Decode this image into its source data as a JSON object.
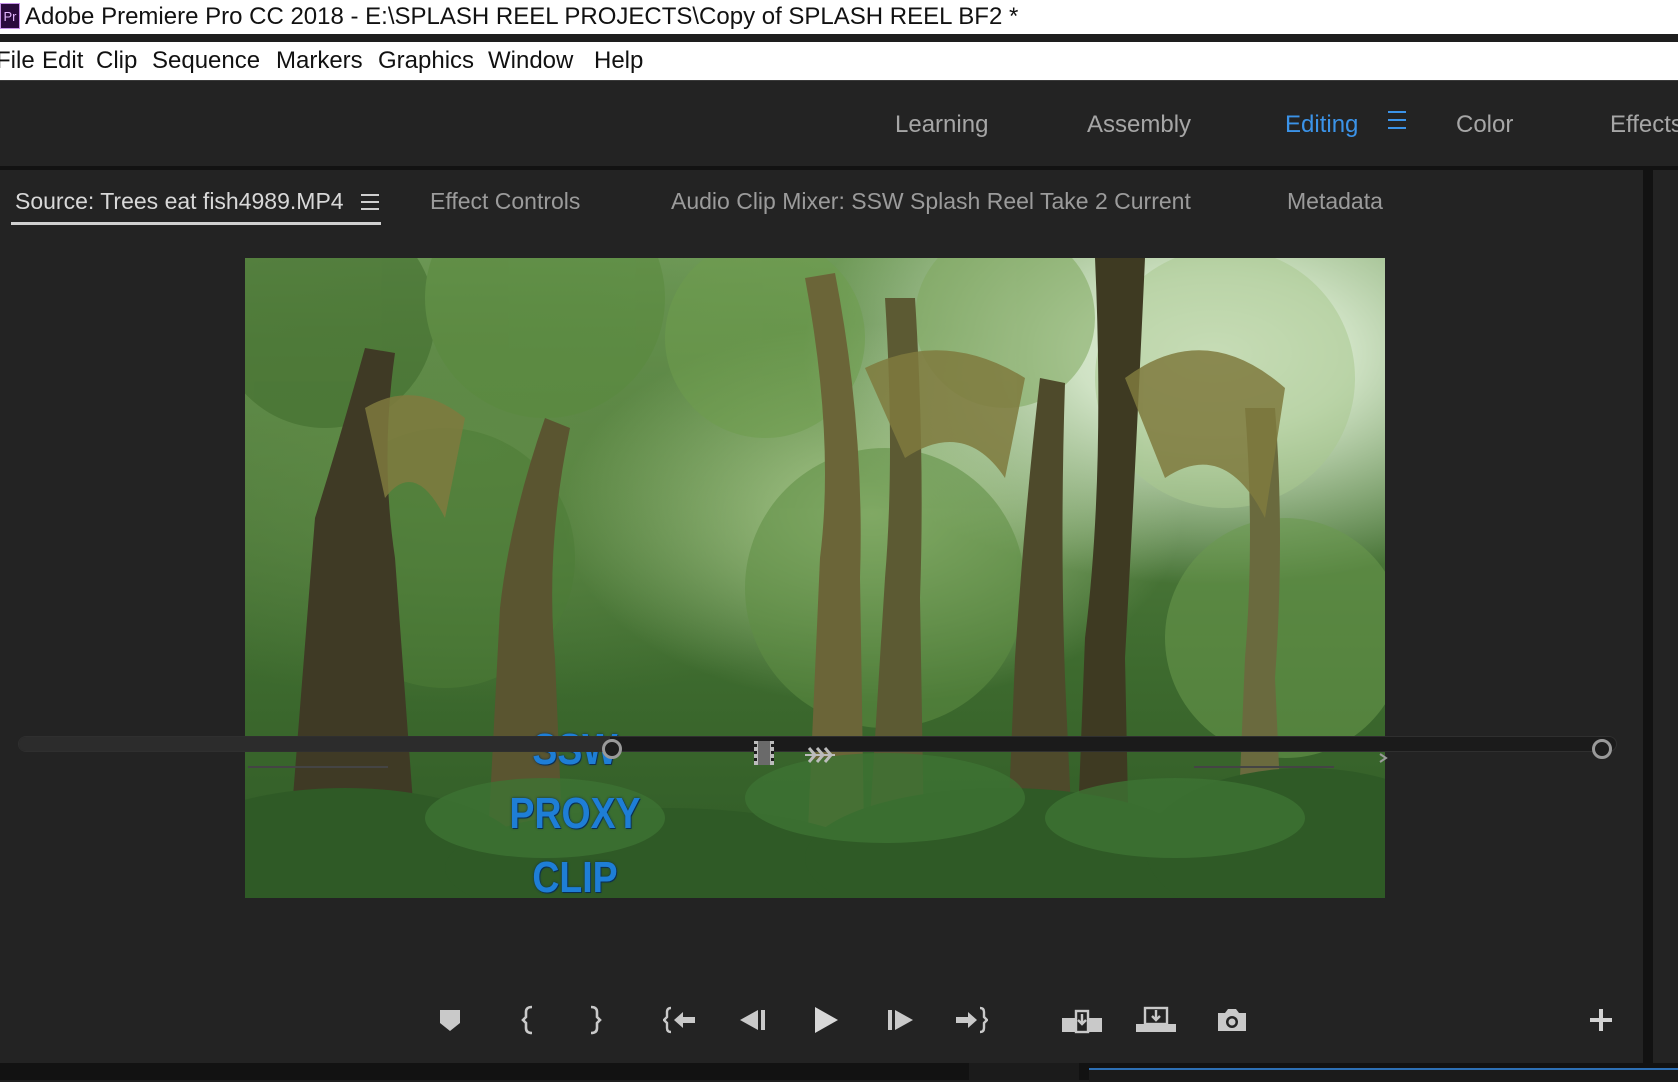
{
  "titlebar": {
    "app_icon": "Pr",
    "title": "Adobe Premiere Pro CC 2018 - E:\\SPLASH REEL PROJECTS\\Copy of SPLASH REEL BF2 *"
  },
  "menu": {
    "items": [
      "File",
      "Edit",
      "Clip",
      "Sequence",
      "Markers",
      "Graphics",
      "Window",
      "Help"
    ]
  },
  "workspaces": {
    "tabs": [
      "Learning",
      "Assembly",
      "Editing",
      "Color",
      "Effects"
    ],
    "active": "Editing"
  },
  "panel": {
    "tabs": [
      "Source: Trees eat fish4989.MP4",
      "Effect Controls",
      "Audio Clip Mixer: SSW Splash Reel Take 2 Current",
      "Metadata"
    ],
    "active_index": 0
  },
  "video": {
    "overlay_lines": [
      "SSW",
      "PROXY",
      "CLIP"
    ],
    "overlay_color": "#1e7ed6"
  },
  "scrubber": {
    "playhead_fraction": 0.37
  },
  "colors": {
    "accent": "#3b93e8",
    "panel_bg": "#232323",
    "icon_gray": "#c9c9c9"
  },
  "transport": {
    "icons": [
      "add-marker-icon",
      "mark-in-icon",
      "mark-out-icon",
      "go-to-in-icon",
      "step-back-icon",
      "play-icon",
      "step-forward-icon",
      "go-to-out-icon",
      "insert-icon",
      "overwrite-icon",
      "export-frame-icon",
      "button-editor-icon"
    ]
  }
}
